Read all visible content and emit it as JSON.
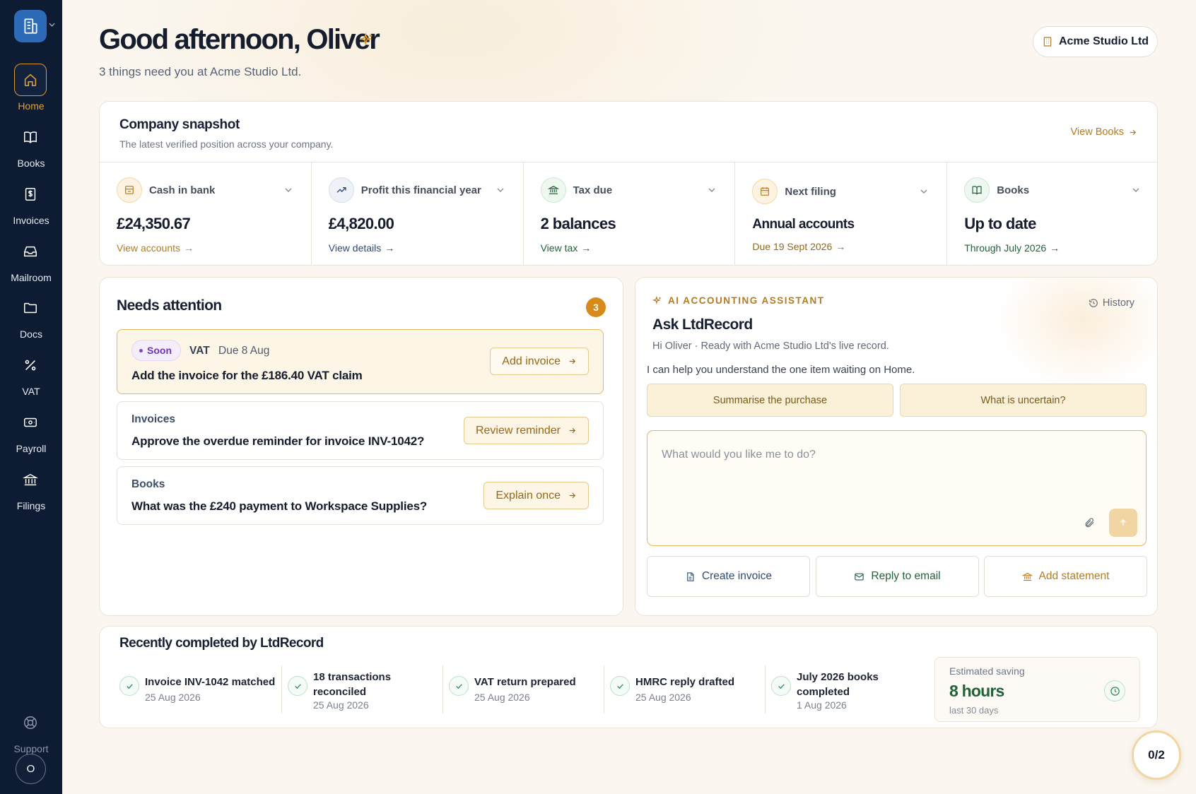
{
  "sidebar": {
    "items": [
      {
        "label": "Home",
        "icon": "home-icon",
        "active": true
      },
      {
        "label": "Books",
        "icon": "book-icon"
      },
      {
        "label": "Invoices",
        "icon": "invoice-icon"
      },
      {
        "label": "Mailroom",
        "icon": "inbox-icon"
      },
      {
        "label": "Docs",
        "icon": "folder-icon"
      },
      {
        "label": "VAT",
        "icon": "percent-icon"
      },
      {
        "label": "Payroll",
        "icon": "wallet-icon"
      },
      {
        "label": "Filings",
        "icon": "bank-icon"
      }
    ],
    "support_label": "Support",
    "avatar_initial": "O"
  },
  "header": {
    "greeting": "Good afternoon, Oliver",
    "subtitle": "3 things need you at Acme Studio Ltd.",
    "company_button": "Acme Studio Ltd"
  },
  "snapshot": {
    "title": "Company snapshot",
    "subtitle": "The latest verified position across your company.",
    "view_books": "View Books",
    "metrics": [
      {
        "label": "Cash in bank",
        "value": "£24,350.67",
        "link": "View accounts",
        "icon": "wallet-icon",
        "link_color": "#b57b20"
      },
      {
        "label": "Profit this financial year",
        "value": "£4,820.00",
        "link": "View details",
        "icon": "trending-up-icon",
        "link_color": "#2f4a78"
      },
      {
        "label": "Tax due",
        "value": "2 balances",
        "link": "View tax",
        "icon": "bank-icon",
        "link_color": "#23613a"
      },
      {
        "label": "Next filing",
        "value": "Annual accounts",
        "link": "Due 19 Sept 2026",
        "icon": "calendar-icon",
        "link_color": "#9a6616"
      },
      {
        "label": "Books",
        "value": "Up to date",
        "link": "Through July 2026",
        "icon": "book-icon",
        "link_color": "#23613a"
      }
    ]
  },
  "attention": {
    "title": "Needs attention",
    "count": "3",
    "tasks": [
      {
        "badge": "Soon",
        "tag": "VAT",
        "due": "Due 8 Aug",
        "text": "Add the invoice for the £186.40 VAT claim",
        "button": "Add invoice"
      },
      {
        "category": "Invoices",
        "text": "Approve the overdue reminder for invoice INV-1042?",
        "button": "Review reminder"
      },
      {
        "category": "Books",
        "text": "What was the £240 payment to Workspace Supplies?",
        "button": "Explain once"
      }
    ]
  },
  "assistant": {
    "tag": "AI ACCOUNTING ASSISTANT",
    "history": "History",
    "title": "Ask LtdRecord",
    "subtitle": "Hi Oliver · Ready with Acme Studio Ltd's live record.",
    "help_text": "I can help you understand the one item waiting on Home.",
    "suggestions": [
      "Summarise the purchase",
      "What is uncertain?"
    ],
    "prompt_placeholder": "What would you like me to do?",
    "actions": [
      {
        "label": "Create invoice",
        "icon": "document-icon",
        "color": "#2f4a78"
      },
      {
        "label": "Reply to email",
        "icon": "mail-icon",
        "color": "#23613a"
      },
      {
        "label": "Add statement",
        "icon": "bank-icon",
        "color": "#b57b20"
      }
    ]
  },
  "recent": {
    "title": "Recently completed by LtdRecord",
    "items": [
      {
        "title": "Invoice INV-1042 matched",
        "date": "25 Aug 2026"
      },
      {
        "title": "18 transactions reconciled",
        "date": "25 Aug 2026"
      },
      {
        "title": "VAT return prepared",
        "date": "25 Aug 2026"
      },
      {
        "title": "HMRC reply drafted",
        "date": "25 Aug 2026"
      },
      {
        "title": "July 2026 books completed",
        "date": "1 Aug 2026"
      }
    ],
    "saving": {
      "label": "Estimated saving",
      "value": "8 hours",
      "period": "last 30 days"
    }
  },
  "progress": {
    "label": "0/2",
    "completed": 0,
    "total": 2
  },
  "colors": {
    "sidebar": "#0d1b33",
    "accent": "#d89a2b",
    "background": "#fbf7f0",
    "success": "#23613a"
  }
}
